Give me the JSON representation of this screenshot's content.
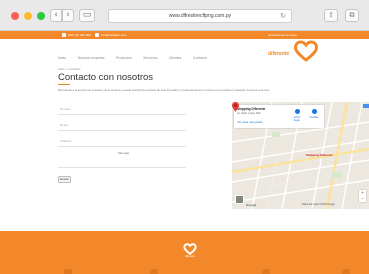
{
  "browser": {
    "url": "www.dlfrestirecftpng.com.py",
    "back_icon": "chevron-left-icon",
    "forward_icon": "chevron-right-icon",
    "reload_icon": "reload-icon"
  },
  "topbar": {
    "phone": "(595 21) 000 000",
    "email": "info@ofisilado.com",
    "right_text": "Cotizaciones en línea"
  },
  "nav": {
    "items": [
      "Inicio",
      "Nuestra empresa",
      "Productos",
      "Servicios",
      "Clientes",
      "Contacto"
    ]
  },
  "logo": {
    "text": "diferente"
  },
  "page": {
    "breadcrumb": "Inicio > Contacto",
    "title": "Contacto con nosotros",
    "intro": "Bienvenido a la sección de Contacto de la empresa, puede escribirnos a través de este formulario y responderemos en breve a su consulta o inquietud, de lunes a viernes."
  },
  "form": {
    "name_label": "Nombre",
    "email_label": "Email",
    "phone_label": "Teléfono",
    "message_label": "Mensaje",
    "send_label": "Enviar"
  },
  "map": {
    "place_name": "Shipping Diferente",
    "address": "Av. Mcal. López 000",
    "link": "Ver mapa más grande",
    "directions_label": "Cómo llegar",
    "save_label": "Guardar",
    "pin_label": "Shipping Diferente",
    "google_label": "Google",
    "footer_text": "Datos del mapa ©2018 Google"
  },
  "colors": {
    "brand_orange": "#f2882a",
    "map_link": "#1a73e8"
  }
}
